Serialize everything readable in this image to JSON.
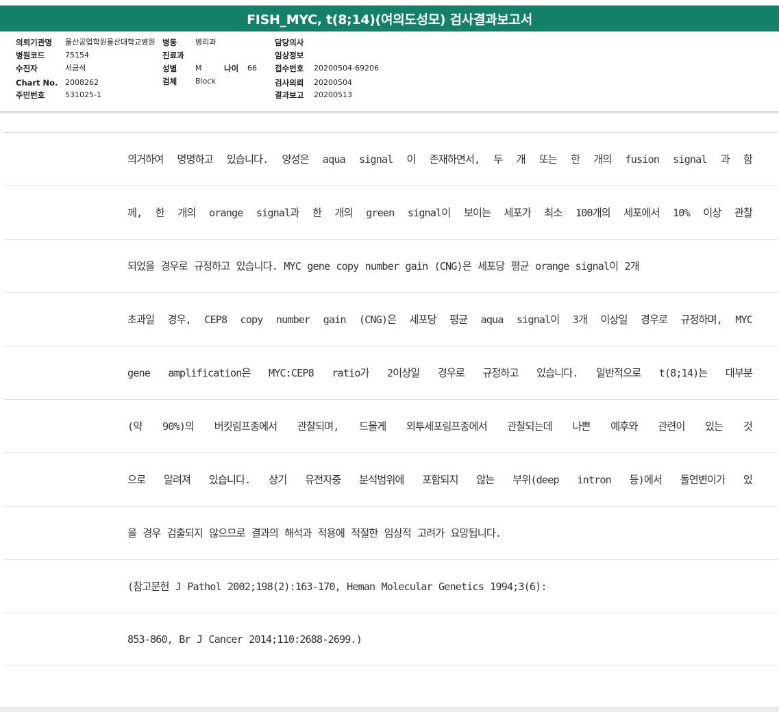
{
  "title": "FISH_MYC, t(8;14)(여의도성모) 검사결과보고서",
  "header": {
    "institution_label": "의뢰기관명",
    "institution_value": "울산공업학원울산대학교병원",
    "ward_label": "병동",
    "ward_value": "병리과",
    "hospital_code_label": "병원코드",
    "hospital_code_value": "75154",
    "patient_label": "수진자",
    "patient_value": "서금석",
    "chart_no_label": "Chart No.",
    "chart_no_value": "2008262",
    "resident_no_label": "주민번호",
    "resident_no_value": "531025-1",
    "department_label": "진료과",
    "sex_label": "성별",
    "sex_value": "M",
    "age_label": "나이",
    "age_value": "66",
    "specimen_label": "검체",
    "specimen_value": "Block",
    "doctor_label": "담당의사",
    "clinical_info_label": "임상정보",
    "receipt_no_label": "접수번호",
    "receipt_no_value": "20200504-69206",
    "request_date_label": "검사의뢰",
    "request_date_value": "20200504",
    "report_date_label": "결과보고",
    "report_date_value": "20200513"
  },
  "report_lines": [
    "의거하여 명명하고 있습니다. 양성은 aqua signal 이 존재하면서, 두 개 또는 한 개의 fusion signal 과 함",
    "께, 한 개의 orange signal과 한 개의 green signal이 보이는 세포가 최소 100개의 세포에서 10% 이상 관찰",
    "되었을 경우로 규정하고 있습니다. MYC gene copy number gain (CNG)은 세포당 평균 orange signal이 2개",
    "초과일 경우, CEP8 copy number gain (CNG)은 세포당 평균 aqua signal이 3개 이상일 경우로 규정하며, MYC",
    " gene amplification은 MYC:CEP8 ratio가 2이상일 경우로 규정하고 있습니다. 일반적으로 t(8;14)는 대부분",
    "(약 90%)의 버킷림프종에서 관찰되며, 드물게 외투세포림프종에서 관찰되는데 나쁜 예후와 관련이 있는 것",
    "으로 알려져 있습니다. 상기 유전자중 분석범위에 포함되지 않는 부위(deep intron 등)에서 돌연변이가 있",
    "을 경우 검출되지 않으므로 결과의 해석과 적용에 적절한 임상적 고려가 요망됩니다.",
    "(참고문헌 J Pathol 2002;198(2):163-170, Heman Molecular Genetics 1994;3(6):",
    "853-860, Br J Cancer 2014;110:2688-2699.)"
  ]
}
